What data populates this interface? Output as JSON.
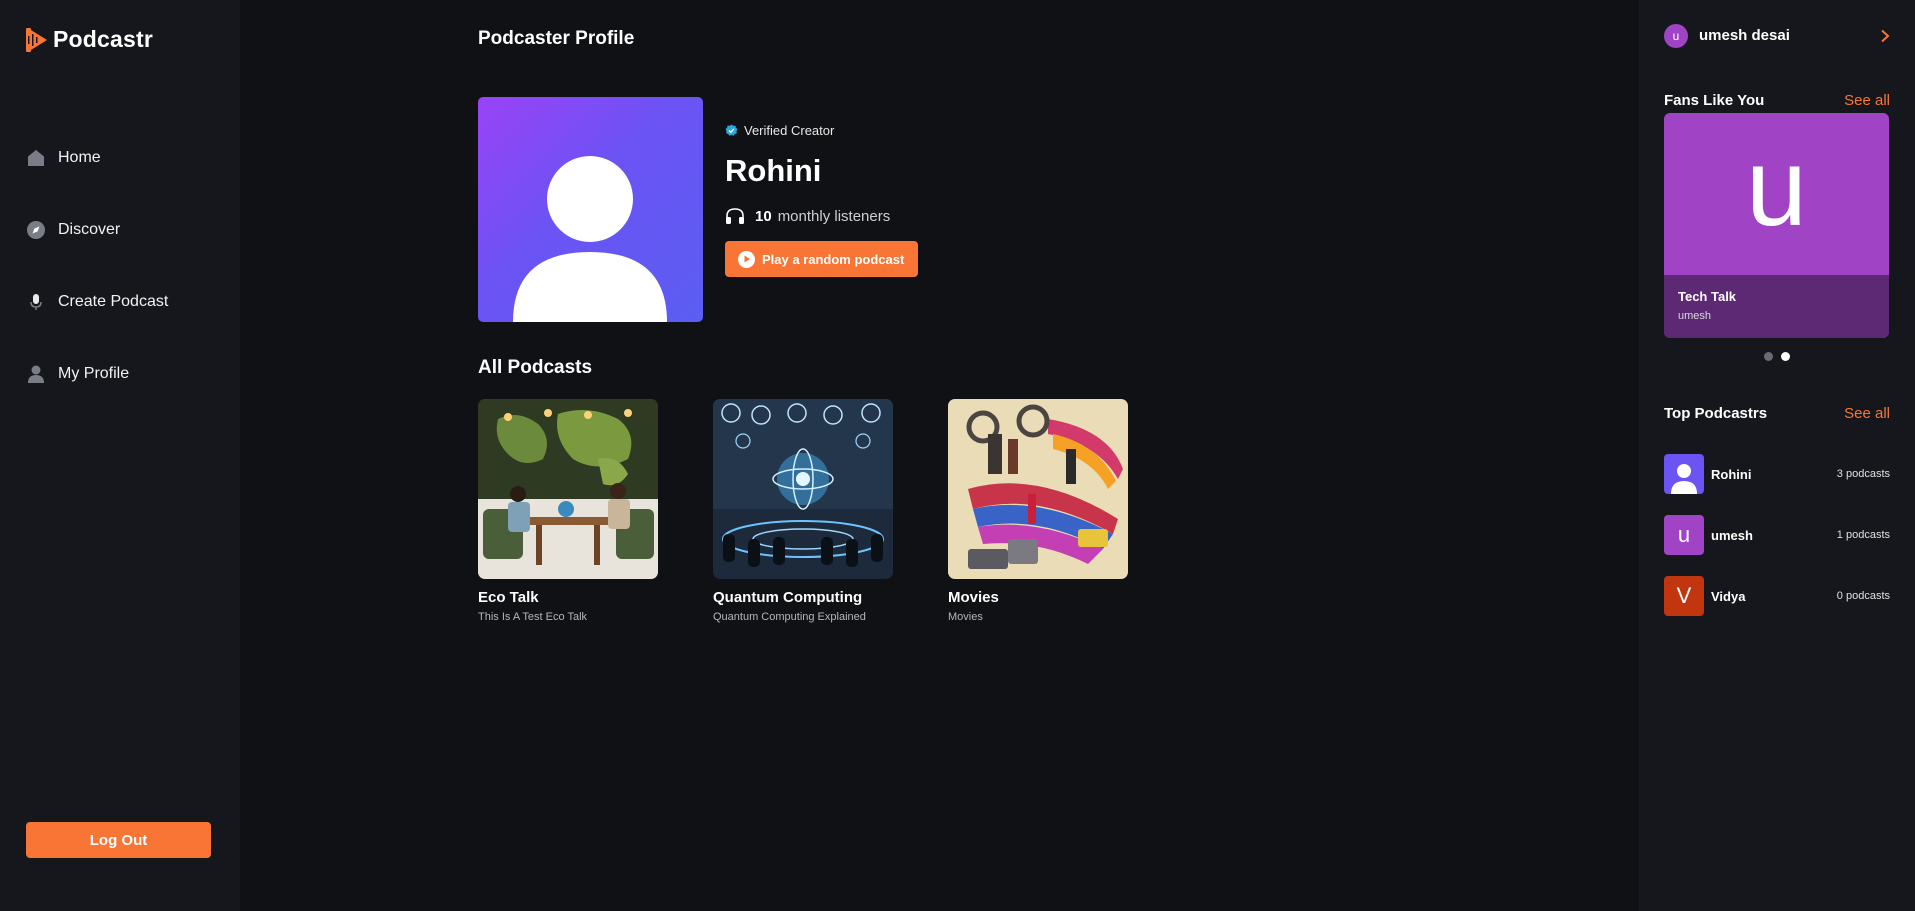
{
  "app": {
    "name": "Podcastr"
  },
  "sidebar": {
    "items": [
      {
        "label": "Home",
        "icon": "home-icon"
      },
      {
        "label": "Discover",
        "icon": "compass-icon"
      },
      {
        "label": "Create Podcast",
        "icon": "microphone-icon"
      },
      {
        "label": "My Profile",
        "icon": "user-icon"
      }
    ],
    "logout_label": "Log Out"
  },
  "main": {
    "page_title": "Podcaster Profile",
    "profile": {
      "verified_label": "Verified Creator",
      "name": "Rohini",
      "listeners_count": "10",
      "listeners_label": "monthly listeners",
      "play_button_label": "Play a random podcast"
    },
    "podcasts_section_title": "All Podcasts",
    "podcasts": [
      {
        "title": "Eco Talk",
        "description": "This Is A Test Eco Talk"
      },
      {
        "title": "Quantum Computing",
        "description": "Quantum Computing Explained"
      },
      {
        "title": "Movies",
        "description": "Movies"
      }
    ]
  },
  "right_sidebar": {
    "user": {
      "initial": "u",
      "name": "umesh desai"
    },
    "fans": {
      "title": "Fans Like You",
      "see_all": "See all",
      "card": {
        "letter": "u",
        "title": "Tech Talk",
        "author": "umesh"
      },
      "active_slide": 2,
      "slide_count": 2
    },
    "top": {
      "title": "Top Podcastrs",
      "see_all": "See all",
      "items": [
        {
          "name": "Rohini",
          "count": "3 podcasts",
          "initial": "",
          "color": "#6b53f4"
        },
        {
          "name": "umesh",
          "count": "1 podcasts",
          "initial": "u",
          "color": "#a044c5"
        },
        {
          "name": "Vidya",
          "count": "0 podcasts",
          "initial": "V",
          "color": "#c2360f"
        }
      ]
    }
  },
  "colors": {
    "accent": "#f97535",
    "background": "#101114",
    "panel": "#15171c"
  }
}
